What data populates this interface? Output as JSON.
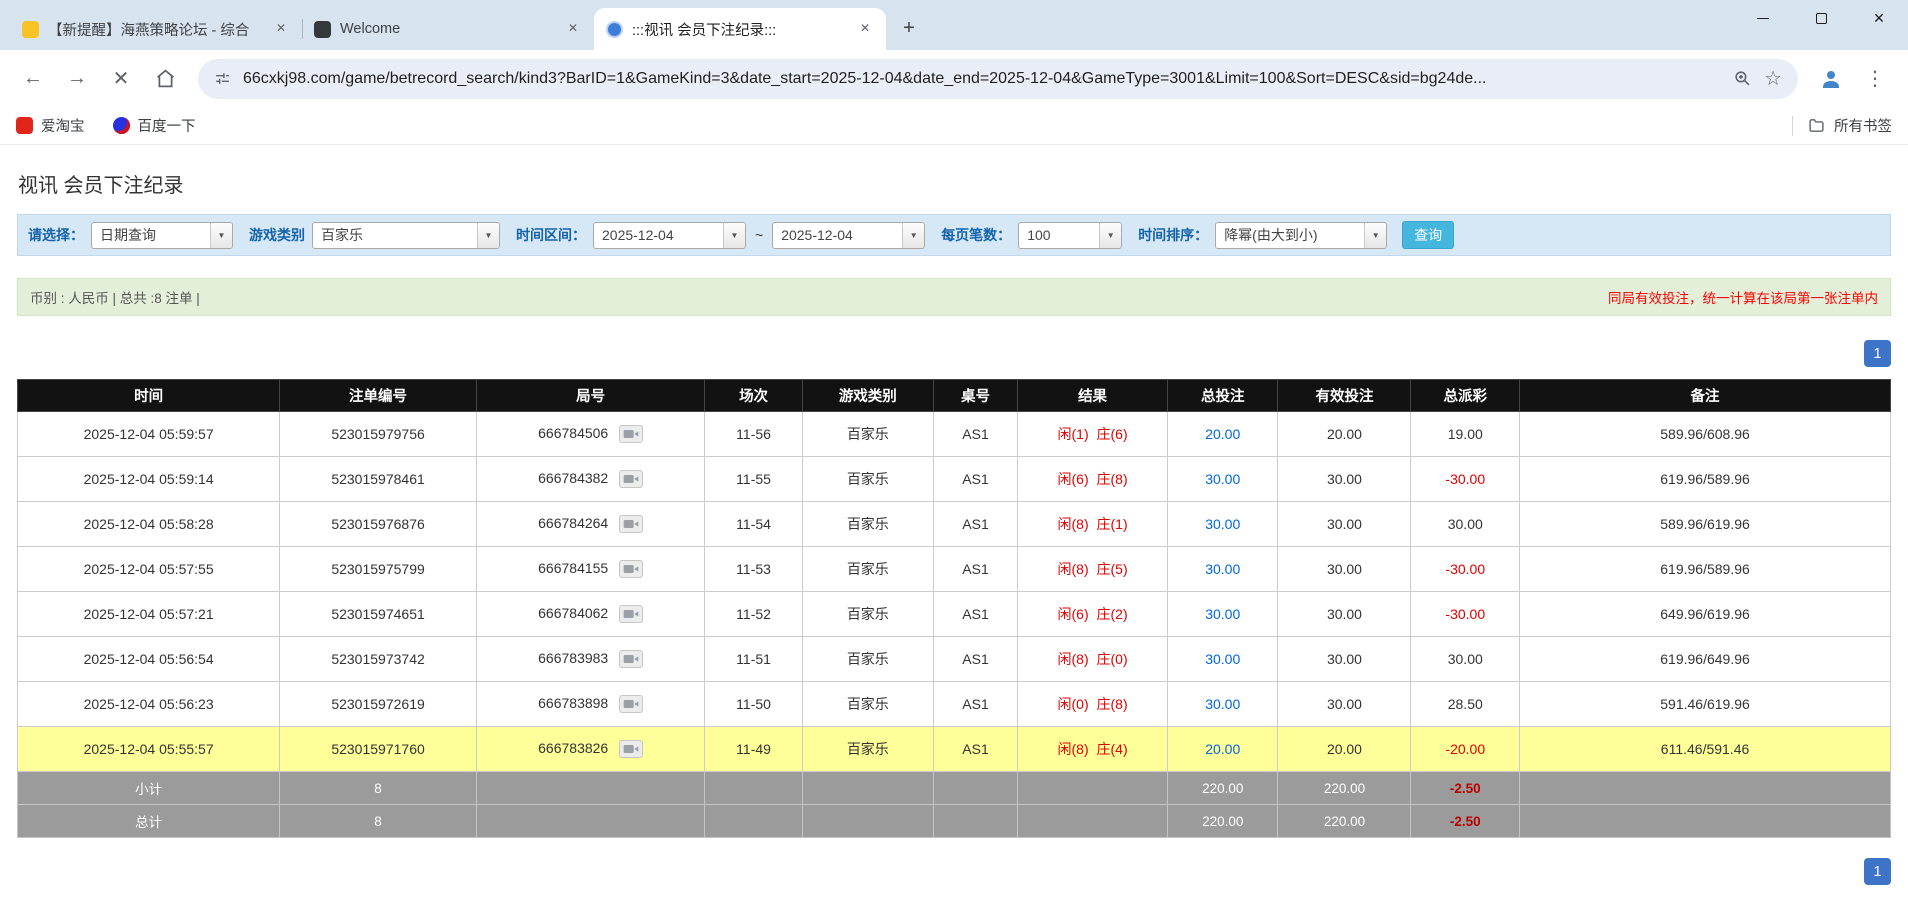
{
  "icons": {
    "close": "✕",
    "new_tab": "+",
    "back": "←",
    "forward": "→",
    "stop": "✕",
    "star": "☆",
    "kebab": "⋮",
    "dropdown_arrow": "▼"
  },
  "browser": {
    "tabs": [
      {
        "title": "【新提醒】海燕策略论坛 - 综合"
      },
      {
        "title": "Welcome"
      },
      {
        "title": ":::视讯 会员下注纪录:::"
      }
    ],
    "url": "66cxkj98.com/game/betrecord_search/kind3?BarID=1&GameKind=3&date_start=2025-12-04&date_end=2025-12-04&GameType=3001&Limit=100&Sort=DESC&sid=bg24de...",
    "bookmarks": {
      "items": [
        {
          "label": "爱淘宝"
        },
        {
          "label": "百度一下"
        }
      ],
      "all_bookmarks": "所有书签"
    }
  },
  "page": {
    "title": "视讯 会员下注纪录",
    "filters": {
      "select_label": "请选择：",
      "select_value": "日期查询",
      "game_type_label": "游戏类别",
      "game_type_value": "百家乐",
      "date_range_label": "时间区间：",
      "date_start": "2025-12-04",
      "date_separator": "~",
      "date_end": "2025-12-04",
      "page_size_label": "每页笔数：",
      "page_size_value": "100",
      "sort_label": "时间排序：",
      "sort_value": "降幂(由大到小)",
      "query_button": "查询"
    },
    "summary": {
      "left": "币别 : 人民币 | 总共 :8 注单 |",
      "right": "同局有效投注，统一计算在该局第一张注单内"
    },
    "pagination": "1",
    "table": {
      "headers": [
        "时间",
        "注单编号",
        "局号",
        "场次",
        "游戏类别",
        "桌号",
        "结果",
        "总投注",
        "有效投注",
        "总派彩",
        "备注"
      ],
      "rows": [
        {
          "time": "2025-12-04 05:59:57",
          "bet_id": "523015979756",
          "round_id": "666784506",
          "session": "11-56",
          "game": "百家乐",
          "table_no": "AS1",
          "result_player": "闲(1)",
          "result_banker": "庄(6)",
          "total_bet": "20.00",
          "valid_bet": "20.00",
          "payout": "19.00",
          "note": "589.96/608.96",
          "highlight": false
        },
        {
          "time": "2025-12-04 05:59:14",
          "bet_id": "523015978461",
          "round_id": "666784382",
          "session": "11-55",
          "game": "百家乐",
          "table_no": "AS1",
          "result_player": "闲(6)",
          "result_banker": "庄(8)",
          "total_bet": "30.00",
          "valid_bet": "30.00",
          "payout": "-30.00",
          "note": "619.96/589.96",
          "highlight": false
        },
        {
          "time": "2025-12-04 05:58:28",
          "bet_id": "523015976876",
          "round_id": "666784264",
          "session": "11-54",
          "game": "百家乐",
          "table_no": "AS1",
          "result_player": "闲(8)",
          "result_banker": "庄(1)",
          "total_bet": "30.00",
          "valid_bet": "30.00",
          "payout": "30.00",
          "note": "589.96/619.96",
          "highlight": false
        },
        {
          "time": "2025-12-04 05:57:55",
          "bet_id": "523015975799",
          "round_id": "666784155",
          "session": "11-53",
          "game": "百家乐",
          "table_no": "AS1",
          "result_player": "闲(8)",
          "result_banker": "庄(5)",
          "total_bet": "30.00",
          "valid_bet": "30.00",
          "payout": "-30.00",
          "note": "619.96/589.96",
          "highlight": false
        },
        {
          "time": "2025-12-04 05:57:21",
          "bet_id": "523015974651",
          "round_id": "666784062",
          "session": "11-52",
          "game": "百家乐",
          "table_no": "AS1",
          "result_player": "闲(6)",
          "result_banker": "庄(2)",
          "total_bet": "30.00",
          "valid_bet": "30.00",
          "payout": "-30.00",
          "note": "649.96/619.96",
          "highlight": false
        },
        {
          "time": "2025-12-04 05:56:54",
          "bet_id": "523015973742",
          "round_id": "666783983",
          "session": "11-51",
          "game": "百家乐",
          "table_no": "AS1",
          "result_player": "闲(8)",
          "result_banker": "庄(0)",
          "total_bet": "30.00",
          "valid_bet": "30.00",
          "payout": "30.00",
          "note": "619.96/649.96",
          "highlight": false
        },
        {
          "time": "2025-12-04 05:56:23",
          "bet_id": "523015972619",
          "round_id": "666783898",
          "session": "11-50",
          "game": "百家乐",
          "table_no": "AS1",
          "result_player": "闲(0)",
          "result_banker": "庄(8)",
          "total_bet": "30.00",
          "valid_bet": "30.00",
          "payout": "28.50",
          "note": "591.46/619.96",
          "highlight": false
        },
        {
          "time": "2025-12-04 05:55:57",
          "bet_id": "523015971760",
          "round_id": "666783826",
          "session": "11-49",
          "game": "百家乐",
          "table_no": "AS1",
          "result_player": "闲(8)",
          "result_banker": "庄(4)",
          "total_bet": "20.00",
          "valid_bet": "20.00",
          "payout": "-20.00",
          "note": "611.46/591.46",
          "highlight": true
        }
      ],
      "subtotal": {
        "label": "小计",
        "count": "8",
        "total_bet": "220.00",
        "valid_bet": "220.00",
        "payout": "-2.50"
      },
      "total": {
        "label": "总计",
        "count": "8",
        "total_bet": "220.00",
        "valid_bet": "220.00",
        "payout": "-2.50"
      }
    }
  }
}
